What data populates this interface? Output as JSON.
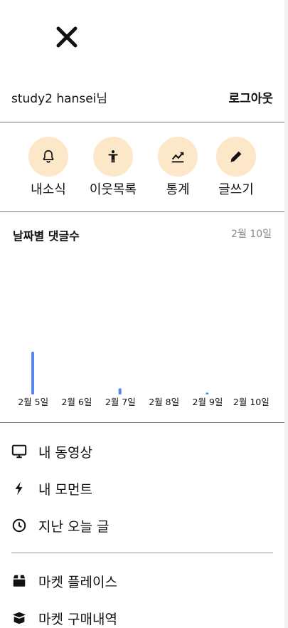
{
  "header": {
    "close_icon": "close-icon",
    "user_name": "study2 hansei님",
    "logout_label": "로그아웃"
  },
  "quick_actions": [
    {
      "label": "내소식",
      "icon": "bell-icon"
    },
    {
      "label": "이웃목록",
      "icon": "person-icon"
    },
    {
      "label": "통계",
      "icon": "chart-icon"
    },
    {
      "label": "글쓰기",
      "icon": "pencil-icon"
    }
  ],
  "chart_data": {
    "type": "bar",
    "title": "날짜별 댓글수",
    "date_label": "2월 10일",
    "categories": [
      "2월 5일",
      "2월 6일",
      "2월 7일",
      "2월 8일",
      "2월 9일",
      "2월 10일"
    ],
    "values": [
      7,
      0,
      1,
      0,
      0.3,
      0
    ],
    "ylim": [
      0,
      7
    ],
    "bar_color": "#5a86f0"
  },
  "menu": [
    {
      "label": "내 동영상",
      "icon": "monitor-icon"
    },
    {
      "label": "내 모먼트",
      "icon": "lightning-icon"
    },
    {
      "label": "지난 오늘 글",
      "icon": "clock-icon"
    },
    {
      "label": "마켓 플레이스",
      "icon": "box-icon"
    },
    {
      "label": "마켓 구매내역",
      "icon": "open-box-icon"
    }
  ],
  "colors": {
    "accent_circle": "#fde7c9",
    "divider": "#777777"
  }
}
